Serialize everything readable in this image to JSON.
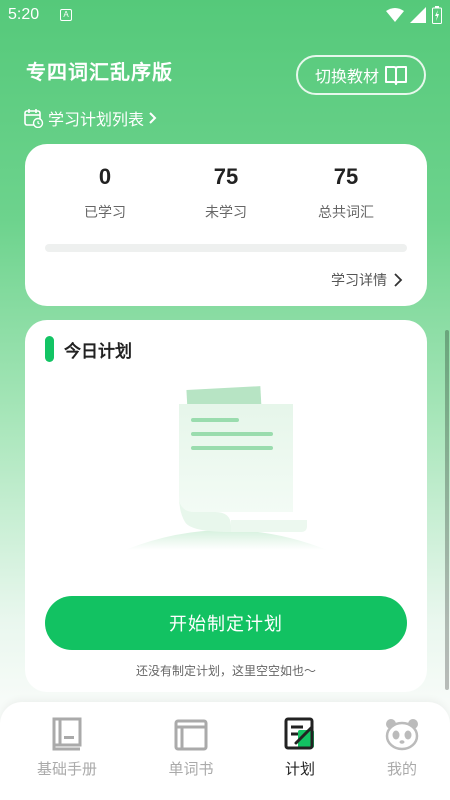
{
  "status": {
    "time": "5:20",
    "notif_letter": "A"
  },
  "header": {
    "title": "专四词汇乱序版",
    "switch_label": "切换教材",
    "plan_list_label": "学习计划列表"
  },
  "stats": {
    "learned": {
      "value": "0",
      "label": "已学习"
    },
    "unlearned": {
      "value": "75",
      "label": "未学习"
    },
    "total": {
      "value": "75",
      "label": "总共词汇"
    },
    "progress": 0,
    "detail_label": "学习详情"
  },
  "today": {
    "title": "今日计划",
    "start_label": "开始制定计划",
    "empty_note": "还没有制定计划，这里空空如也～"
  },
  "nav": {
    "items": [
      {
        "label": "基础手册",
        "icon": "handbook-icon",
        "active": false
      },
      {
        "label": "单词书",
        "icon": "wordbook-icon",
        "active": false
      },
      {
        "label": "计划",
        "icon": "plan-icon",
        "active": true
      },
      {
        "label": "我的",
        "icon": "panda-icon",
        "active": false
      }
    ]
  },
  "colors": {
    "accent": "#12c262",
    "header_bg": "#55c97a",
    "inactive": "#aaaaaa"
  }
}
